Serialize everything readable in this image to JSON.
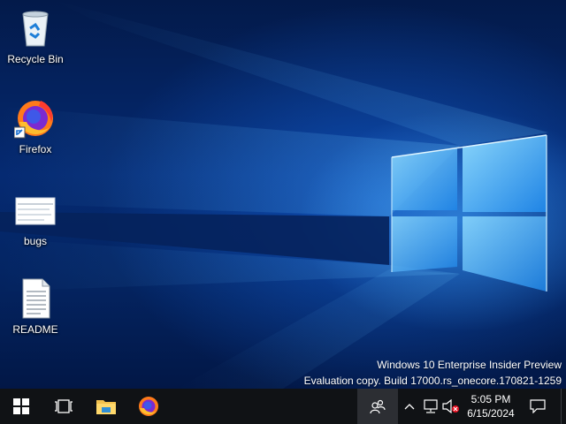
{
  "desktop": {
    "icons": [
      {
        "label": "Recycle Bin",
        "icon": "recycle-bin-icon"
      },
      {
        "label": "Firefox",
        "icon": "firefox-icon"
      },
      {
        "label": "bugs",
        "icon": "image-file-icon"
      },
      {
        "label": "README",
        "icon": "text-document-icon"
      }
    ],
    "watermark": {
      "line1": "Windows 10 Enterprise Insider Preview",
      "line2": "Evaluation copy. Build 17000.rs_onecore.170821-1259"
    }
  },
  "taskbar": {
    "start": "windows-start-icon",
    "task_view": "task-view-icon",
    "pinned": [
      "file-explorer-icon",
      "firefox-icon"
    ],
    "tray_icons": [
      "people-icon",
      "chevron-up-icon",
      "network-icon",
      "volume-muted-icon",
      "action-center-icon"
    ],
    "clock": {
      "time": "5:05 PM",
      "date": "6/15/2024"
    }
  },
  "colors": {
    "taskbar_bg": "#101215",
    "desktop_blue": "#0a3fa0",
    "light_blue": "#5cc8ff"
  }
}
